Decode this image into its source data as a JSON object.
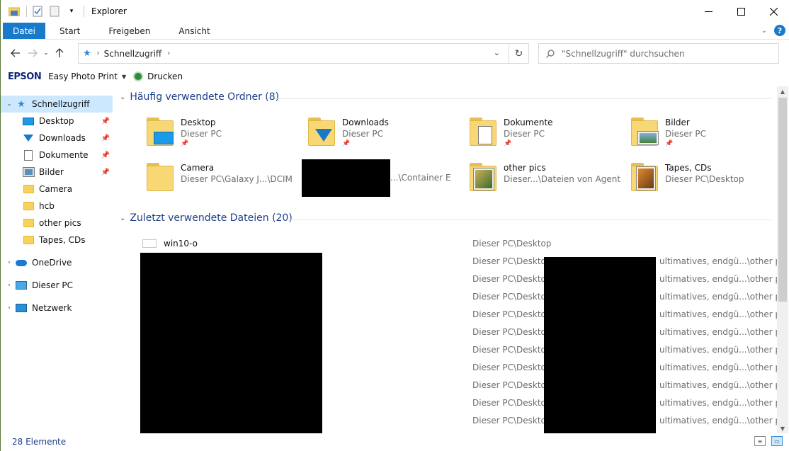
{
  "window": {
    "title": "Explorer"
  },
  "ribbon": {
    "tabs": [
      "Datei",
      "Start",
      "Freigeben",
      "Ansicht"
    ],
    "help": "?"
  },
  "address": {
    "segment": "Schnellzugriff",
    "search_placeholder": "\"Schnellzugriff\" durchsuchen"
  },
  "toolbar": {
    "brand": "EPSON",
    "easy_photo": "Easy Photo Print",
    "print": "Drucken"
  },
  "nav": {
    "quick_access": "Schnellzugriff",
    "pinned": [
      {
        "label": "Desktop",
        "icon": "desktop-icon"
      },
      {
        "label": "Downloads",
        "icon": "download-icon"
      },
      {
        "label": "Dokumente",
        "icon": "document-icon"
      },
      {
        "label": "Bilder",
        "icon": "pictures-icon"
      }
    ],
    "recent": [
      "Camera",
      "hcb",
      "other pics",
      "Tapes, CDs"
    ],
    "roots": [
      {
        "label": "OneDrive",
        "icon": "cloud-icon"
      },
      {
        "label": "Dieser PC",
        "icon": "computer-icon"
      },
      {
        "label": "Netzwerk",
        "icon": "network-icon"
      }
    ]
  },
  "frequent": {
    "header": "Häufig verwendete Ordner (8)",
    "folders": [
      {
        "name": "Desktop",
        "location": "Dieser PC",
        "pinned": true,
        "icon": "desktop-folder-icon"
      },
      {
        "name": "Downloads",
        "location": "Dieser PC",
        "pinned": true,
        "icon": "downloads-folder-icon"
      },
      {
        "name": "Dokumente",
        "location": "Dieser PC",
        "pinned": true,
        "icon": "documents-folder-icon"
      },
      {
        "name": "Bilder",
        "location": "Dieser PC",
        "pinned": true,
        "icon": "pictures-folder-icon"
      },
      {
        "name": "Camera",
        "location": "Dieser PC\\Galaxy J...\\DCIM",
        "pinned": false,
        "icon": "folder-icon"
      },
      {
        "name": "",
        "location": "...\\Container E",
        "pinned": false,
        "icon": "folder-icon"
      },
      {
        "name": "other pics",
        "location": "Dieser...\\Dateien von Agent",
        "pinned": false,
        "icon": "photo-folder-icon"
      },
      {
        "name": "Tapes, CDs",
        "location": "Dieser PC\\Desktop",
        "pinned": false,
        "icon": "photo-folder-icon"
      }
    ]
  },
  "recent_files": {
    "header": "Zuletzt verwendete Dateien (20)",
    "first": {
      "name": "win10-o",
      "location": "Dieser PC\\Desktop"
    },
    "rows": [
      {
        "loc_start": "Dieser PC\\Desktop\\",
        "loc_end": "ultimatives, endgü...\\other pics"
      },
      {
        "loc_start": "Dieser PC\\Desktop\\",
        "loc_end": "ultimatives, endgü...\\other pics"
      },
      {
        "loc_start": "Dieser PC\\Desktop\\",
        "loc_end": "ultimatives, endgü...\\other pics"
      },
      {
        "loc_start": "Dieser PC\\Desktop\\",
        "loc_end": "ultimatives, endgü...\\other pics"
      },
      {
        "loc_start": "Dieser PC\\Desktop\\",
        "loc_end": "ultimatives, endgü...\\other pics"
      },
      {
        "loc_start": "Dieser PC\\Desktop\\",
        "loc_end": "ultimatives, endgü...\\other pics"
      },
      {
        "loc_start": "Dieser PC\\Desktop\\",
        "loc_end": "ultimatives, endgü...\\other pics"
      },
      {
        "loc_start": "Dieser PC\\Desktop\\",
        "loc_end": "ultimatives, endgü...\\other pics"
      },
      {
        "loc_start": "Dieser PC\\Desktop\\",
        "loc_end": "ultimatives, endgü...\\other pics"
      },
      {
        "loc_start": "Dieser PC\\Desktop\\",
        "loc_end": "ultimatives, endgü...\\other pics"
      }
    ]
  },
  "status": {
    "count": "28 Elemente"
  },
  "colors": {
    "accent": "#1979ca",
    "selection": "#cce8ff",
    "group_header": "#1e3f8a"
  }
}
